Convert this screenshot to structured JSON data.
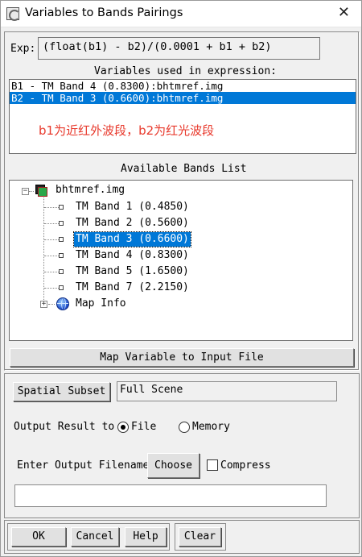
{
  "window": {
    "title": "Variables to Bands Pairings",
    "close_glyph": "✕"
  },
  "expression": {
    "label": "Exp:",
    "value": "(float(b1) - b2)/(0.0001 + b1 + b2)"
  },
  "variables": {
    "header": "Variables used in expression:",
    "items": [
      {
        "text": "B1 - TM Band 4 (0.8300):bhtmref.img",
        "selected": false
      },
      {
        "text": "B2 - TM Band 3 (0.6600):bhtmref.img",
        "selected": true
      }
    ],
    "annotation": "b1为近红外波段，b2为红光波段",
    "annotation_color": "#e8392c"
  },
  "bands": {
    "header": "Available Bands List",
    "file": "bhtmref.img",
    "items": [
      {
        "label": "TM Band 1 (0.4850)",
        "selected": false
      },
      {
        "label": "TM Band 2 (0.5600)",
        "selected": false
      },
      {
        "label": "TM Band 3 (0.6600)",
        "selected": true
      },
      {
        "label": "TM Band 4 (0.8300)",
        "selected": false
      },
      {
        "label": "TM Band 5 (1.6500)",
        "selected": false
      },
      {
        "label": "TM Band 7 (2.2150)",
        "selected": false
      }
    ],
    "map_info": "Map Info",
    "expand_glyph": "+",
    "collapse_glyph": "−"
  },
  "map_button": "Map Variable to Input File",
  "spatial": {
    "button": "Spatial Subset",
    "value": "Full Scene"
  },
  "output": {
    "label": "Output Result to",
    "options": [
      "File",
      "Memory"
    ],
    "selected": "File",
    "filename_label": "Enter Output Filename",
    "choose_button": "Choose",
    "compress_label": "Compress",
    "compress_checked": false,
    "filename_value": ""
  },
  "buttons": {
    "ok": "OK",
    "cancel": "Cancel",
    "help": "Help",
    "clear": "Clear"
  },
  "colors": {
    "selection": "#0078d7",
    "annotation": "#e8392c"
  }
}
